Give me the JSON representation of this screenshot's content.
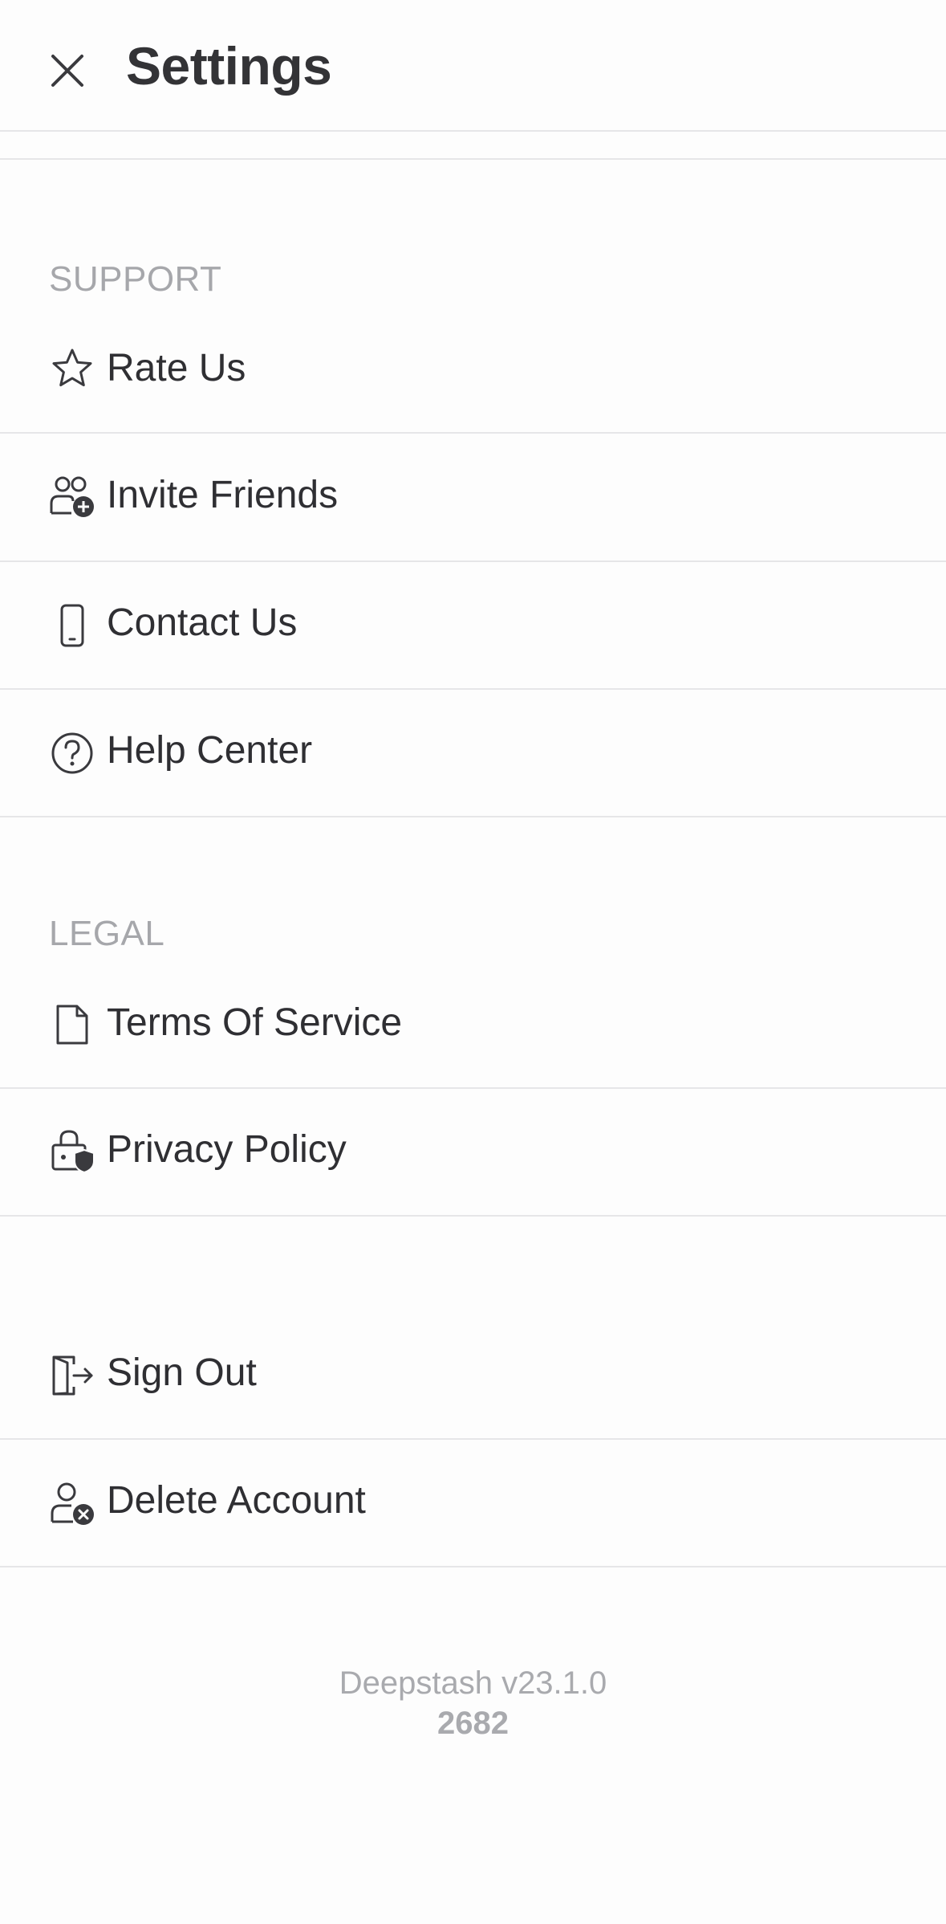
{
  "header": {
    "title": "Settings",
    "close_icon": "close-icon"
  },
  "support": {
    "section_label": "SUPPORT",
    "items": [
      {
        "label": "Rate Us",
        "icon": "star-icon"
      },
      {
        "label": "Invite Friends",
        "icon": "invite-users-icon"
      },
      {
        "label": "Contact Us",
        "icon": "phone-icon"
      },
      {
        "label": "Help Center",
        "icon": "help-circle-icon"
      }
    ]
  },
  "legal": {
    "section_label": "LEGAL",
    "items": [
      {
        "label": "Terms Of Service",
        "icon": "document-icon"
      },
      {
        "label": "Privacy Policy",
        "icon": "lock-shield-icon"
      }
    ]
  },
  "account": {
    "items": [
      {
        "label": "Sign Out",
        "icon": "sign-out-icon"
      },
      {
        "label": "Delete Account",
        "icon": "delete-user-icon"
      }
    ]
  },
  "footer": {
    "version": "Deepstash v23.1.0",
    "build": "2682"
  },
  "colors": {
    "background": "#fdfdfd",
    "text": "#2f2f33",
    "muted": "#a6a7ab",
    "divider": "#e6e6e8"
  }
}
